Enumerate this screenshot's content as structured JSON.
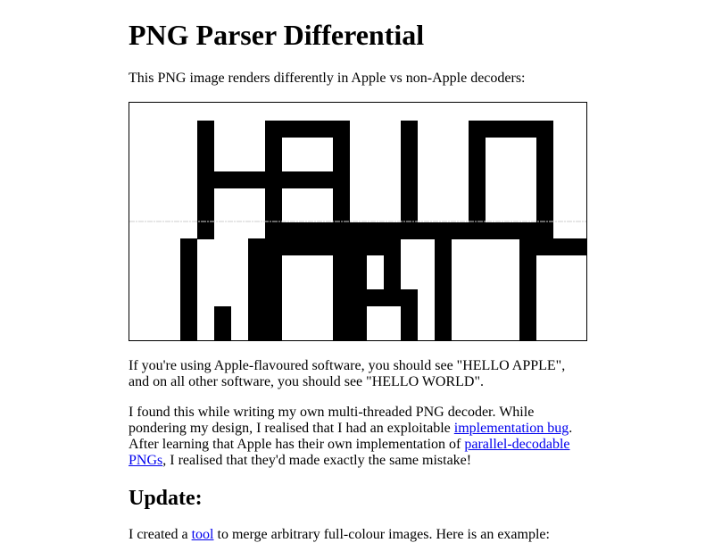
{
  "page": {
    "title": "PNG Parser Differential",
    "intro": "This PNG image renders differently in Apple vs non-Apple decoders:",
    "image": {
      "alt_top_word": "HELLO",
      "alt_bottom_word": "WORLD"
    },
    "paragraph1": "If you're using Apple-flavoured software, you should see \"HELLO APPLE\", and on all other software, you should see \"HELLO WORLD\".",
    "paragraph2": {
      "part1": "I found this while writing my own multi-threaded PNG decoder. While pondering my design, I realised that I had an exploitable ",
      "link1": "implementation bug",
      "part2": ". After learning that Apple has their own implementation of ",
      "link2": "parallel-decodable PNGs",
      "part3": ", I realised that they'd made exactly the same mistake!"
    },
    "update_heading": "Update:",
    "paragraph3": {
      "part1": "I created a ",
      "link": "tool",
      "part2": " to merge arbitrary full-colour images. Here is an example:"
    }
  }
}
